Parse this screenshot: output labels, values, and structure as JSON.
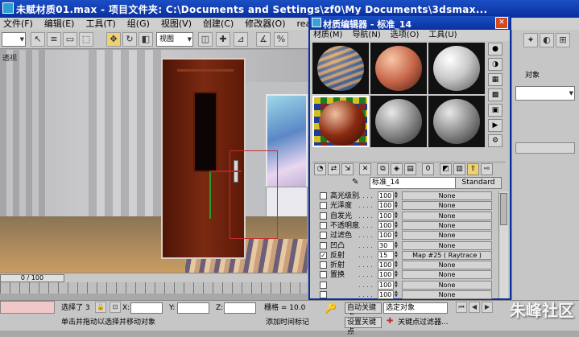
{
  "main": {
    "title": "未赋材质01.max  - 项目文件夹: C:\\Documents and Settings\\zf0\\My Documents\\3dsmax...",
    "menu": [
      "文件(F)",
      "编辑(E)",
      "工具(T)",
      "组(G)",
      "视图(V)",
      "创建(C)",
      "修改器(O)",
      "read"
    ],
    "toolbar": {
      "view_dropdown": "视图"
    },
    "viewport_label": "透视",
    "frame_counter": "0 / 100"
  },
  "status": {
    "selected": "选择了 3",
    "x_label": "X:",
    "y_label": "Y:",
    "z_label": "Z:",
    "grid": "栅格 = 10.0",
    "autokey": "自动关键点",
    "selected_object": "选定对象",
    "set_key": "设置关键点",
    "key_filter": "关键点过滤器...",
    "prompt": "单击并拖动以选择并移动对象",
    "add_time_tag": "添加时间标记"
  },
  "command_panel": {
    "object_label": "对象"
  },
  "material_editor": {
    "title": "材质编辑器 - 标准_14",
    "menu": [
      "材质(M)",
      "导航(N)",
      "选项(O)",
      "工具(U)"
    ],
    "material_name": "标准_14",
    "material_type": "Standard",
    "maps": [
      {
        "label": "高光级别",
        "amount": "100",
        "map": "None",
        "checked": false
      },
      {
        "label": "光泽度",
        "amount": "100",
        "map": "None",
        "checked": false
      },
      {
        "label": "自发光",
        "amount": "100",
        "map": "None",
        "checked": false
      },
      {
        "label": "不透明度",
        "amount": "100",
        "map": "None",
        "checked": false
      },
      {
        "label": "过滤色",
        "amount": "100",
        "map": "None",
        "checked": false
      },
      {
        "label": "凹凸",
        "amount": "30",
        "map": "None",
        "checked": false
      },
      {
        "label": "反射",
        "amount": "15",
        "map": "Map #25  ( Raytrace )",
        "checked": true
      },
      {
        "label": "折射",
        "amount": "100",
        "map": "None",
        "checked": false
      },
      {
        "label": "置换",
        "amount": "100",
        "map": "None",
        "checked": false
      },
      {
        "label": "",
        "amount": "100",
        "map": "None",
        "checked": false
      },
      {
        "label": "",
        "amount": "100",
        "map": "None",
        "checked": false
      }
    ]
  },
  "watermark": "朱峰社区",
  "colors": {
    "titlebar": "#0a2f9e",
    "door": "#5d1a08",
    "panel": "#c6c6c6"
  }
}
